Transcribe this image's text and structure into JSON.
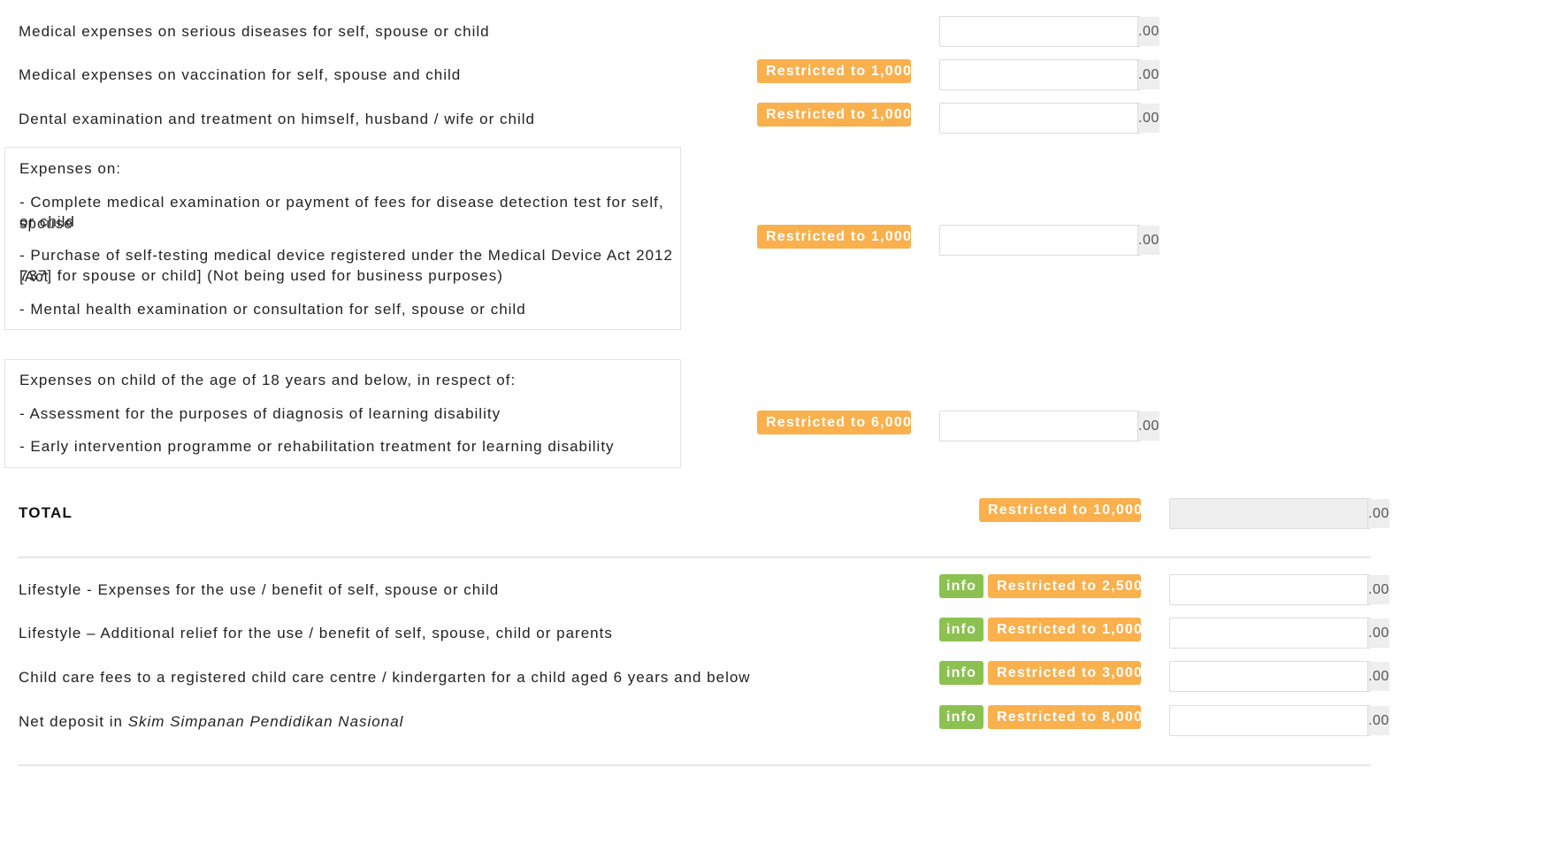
{
  "rows": {
    "serious_diseases": {
      "label": "Medical expenses on serious diseases for self, spouse or child",
      "suffix": ".00",
      "value": ""
    },
    "vaccination": {
      "label": "Medical expenses on vaccination for self, spouse and child",
      "badge": "Restricted to 1,000",
      "suffix": ".00",
      "value": ""
    },
    "dental": {
      "label": "Dental examination and treatment on himself, husband / wife or child",
      "badge": "Restricted to 1,000",
      "suffix": ".00",
      "value": ""
    },
    "medical_exam": {
      "title": "Expenses on:",
      "line1a": "- Complete medical examination or payment of fees for disease detection test for self, spouse",
      "line1b": "or child",
      "line2a": "- Purchase of self-testing medical device registered under the Medical Device Act 2012 [Act",
      "line2b": "737] for spouse or child] (Not being used for business purposes)",
      "line3": "- Mental health examination or consultation for self, spouse or child",
      "badge": "Restricted to 1,000",
      "suffix": ".00",
      "value": ""
    },
    "learning_disability": {
      "title": "Expenses on child of the age of 18 years and below, in respect of:",
      "line1": "- Assessment for the purposes of diagnosis of learning disability",
      "line2": "- Early intervention programme or rehabilitation treatment for learning disability",
      "badge": "Restricted to 6,000",
      "suffix": ".00",
      "value": ""
    },
    "total": {
      "label": "TOTAL",
      "badge": "Restricted to 10,000",
      "suffix": ".00",
      "value": ""
    },
    "lifestyle": {
      "label": "Lifestyle - Expenses for the use / benefit of self, spouse or child",
      "info": "info",
      "badge": "Restricted to 2,500",
      "suffix": ".00",
      "value": ""
    },
    "lifestyle_additional": {
      "label": "Lifestyle – Additional relief for the use / benefit of self, spouse, child or parents",
      "info": "info",
      "badge": "Restricted to 1,000",
      "suffix": ".00",
      "value": ""
    },
    "child_care": {
      "label": "Child care fees to a registered child care centre / kindergarten for a child aged 6 years and below",
      "info": "info",
      "badge": "Restricted to 3,000",
      "suffix": ".00",
      "value": ""
    },
    "sspn": {
      "label_prefix": "Net deposit in ",
      "label_italic": "Skim Simpanan Pendidikan Nasional",
      "info": "info",
      "badge": "Restricted to 8,000",
      "suffix": ".00",
      "value": ""
    }
  },
  "colors": {
    "badge_orange": "#f9b04d",
    "badge_green": "#8cc152",
    "suffix_bg": "#eeeeee"
  }
}
